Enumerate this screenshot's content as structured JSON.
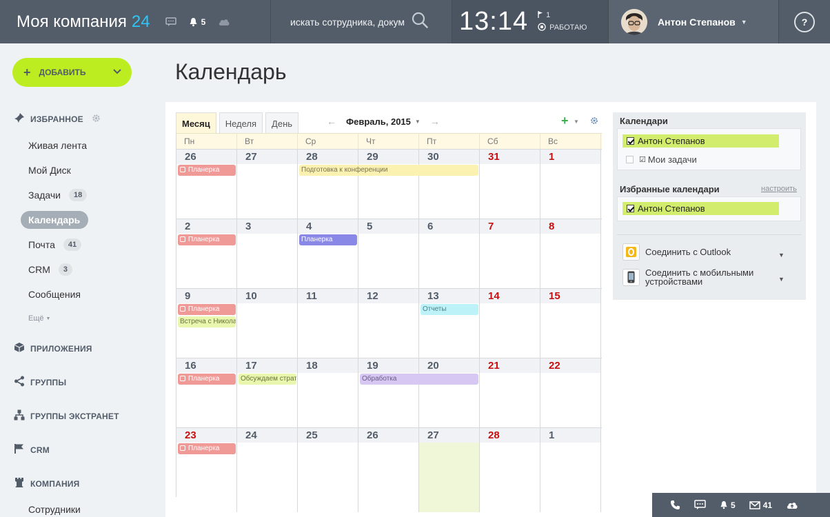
{
  "header": {
    "brand_name": "Моя компания",
    "brand_number": "24",
    "notifications_count": "5",
    "search_placeholder": "искать сотрудника, докум",
    "clock": "13:14",
    "flag_count": "1",
    "work_status": "РАБОТАЮ",
    "user_name": "Антон Степанов",
    "help_label": "?"
  },
  "sidebar": {
    "add_button": "ДОБАВИТЬ",
    "favorites_title": "ИЗБРАННОЕ",
    "items": [
      {
        "label": "Живая лента",
        "count": ""
      },
      {
        "label": "Мой Диск",
        "count": ""
      },
      {
        "label": "Задачи",
        "count": "18"
      },
      {
        "label": "Календарь",
        "count": ""
      },
      {
        "label": "Почта",
        "count": "41"
      },
      {
        "label": "CRM",
        "count": "3"
      },
      {
        "label": "Сообщения",
        "count": ""
      }
    ],
    "more_label": "Ещё",
    "sections": [
      "ПРИЛОЖЕНИЯ",
      "ГРУППЫ",
      "ГРУППЫ ЭКСТРАНЕТ",
      "CRM",
      "КОМПАНИЯ"
    ],
    "sub_item": "Сотрудники"
  },
  "page": {
    "title": "Календарь"
  },
  "calendar": {
    "tabs": [
      "Месяц",
      "Неделя",
      "День"
    ],
    "active_tab": "Месяц",
    "month_label": "Февраль, 2015",
    "weekdays": [
      "Пн",
      "Вт",
      "Ср",
      "Чт",
      "Пт",
      "Сб",
      "Вс"
    ],
    "weeks": [
      {
        "days": [
          "26",
          "27",
          "28",
          "29",
          "30",
          "31",
          "1"
        ],
        "red": [
          5,
          6
        ]
      },
      {
        "days": [
          "2",
          "3",
          "4",
          "5",
          "6",
          "7",
          "8"
        ],
        "red": [
          5,
          6
        ]
      },
      {
        "days": [
          "9",
          "10",
          "11",
          "12",
          "13",
          "14",
          "15"
        ],
        "red": [
          5,
          6
        ]
      },
      {
        "days": [
          "16",
          "17",
          "18",
          "19",
          "20",
          "21",
          "22"
        ],
        "red": [
          5,
          6
        ]
      },
      {
        "days": [
          "23",
          "24",
          "25",
          "26",
          "27",
          "28",
          "1"
        ],
        "red": [
          0,
          5
        ],
        "today": 4
      }
    ],
    "events": [
      {
        "week": 0,
        "day": 0,
        "span": 1,
        "row": 0,
        "title": "Планерка",
        "color": "red",
        "lock": true
      },
      {
        "week": 0,
        "day": 2,
        "span": 3,
        "row": 0,
        "title": "Подготовка к конференции",
        "color": "yellow",
        "lock": false
      },
      {
        "week": 1,
        "day": 0,
        "span": 1,
        "row": 0,
        "title": "Планерка",
        "color": "red",
        "lock": true
      },
      {
        "week": 1,
        "day": 2,
        "span": 1,
        "row": 0,
        "title": "Планерка",
        "color": "violet",
        "lock": false
      },
      {
        "week": 2,
        "day": 0,
        "span": 1,
        "row": 0,
        "title": "Планерка",
        "color": "red",
        "lock": true
      },
      {
        "week": 2,
        "day": 0,
        "span": 1,
        "row": 1,
        "title": "Встреча с Николаем",
        "color": "green",
        "lock": false
      },
      {
        "week": 2,
        "day": 4,
        "span": 1,
        "row": 0,
        "title": "Отчеты",
        "color": "cyan",
        "lock": false
      },
      {
        "week": 3,
        "day": 0,
        "span": 1,
        "row": 0,
        "title": "Планерка",
        "color": "red",
        "lock": true
      },
      {
        "week": 3,
        "day": 1,
        "span": 1,
        "row": 0,
        "title": "Обсуждаем стратегию",
        "color": "green",
        "lock": false
      },
      {
        "week": 3,
        "day": 3,
        "span": 2,
        "row": 0,
        "title": "Обработка",
        "color": "lilac",
        "lock": false
      },
      {
        "week": 4,
        "day": 0,
        "span": 1,
        "row": 0,
        "title": "Планерка",
        "color": "red",
        "lock": true
      }
    ]
  },
  "right_panel": {
    "calendars_title": "Календари",
    "my_calendar": "Антон Степанов",
    "my_tasks": "Мои задачи",
    "favorites_title": "Избранные календари",
    "configure_link": "настроить",
    "favorite_calendar": "Антон Степанов",
    "outlook_label": "Соединить с Outlook",
    "mobile_label_1": "Соединить с мобильными",
    "mobile_label_2": "устройствами"
  },
  "bottom_bar": {
    "notifications": "5",
    "mail": "41"
  },
  "colors": {
    "header_bg": "#535c69",
    "accent_green": "#bbed21",
    "brand_blue": "#2fc6f6",
    "weekend_red": "#c80f0f"
  }
}
